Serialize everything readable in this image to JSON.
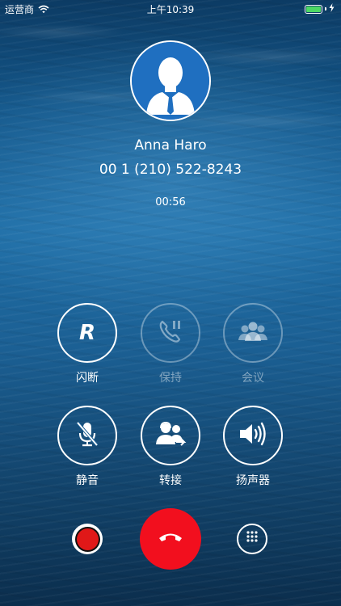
{
  "status_bar": {
    "carrier": "运营商",
    "time": "上午10:39",
    "battery_percent": 100,
    "icons": [
      "wifi-icon",
      "battery-icon",
      "charging-icon"
    ]
  },
  "caller": {
    "name": "Anna  Haro",
    "number": "00 1 (210) 522-8243",
    "duration": "00:56",
    "avatar_icon": "person-avatar-icon"
  },
  "actions": [
    {
      "id": "flash",
      "label": "闪断",
      "icon": "flash-r-icon",
      "glyph": "R",
      "enabled": true
    },
    {
      "id": "hold",
      "label": "保持",
      "icon": "phone-hold-icon",
      "enabled": false
    },
    {
      "id": "conference",
      "label": "会议",
      "icon": "group-icon",
      "enabled": false
    },
    {
      "id": "mute",
      "label": "静音",
      "icon": "mic-muted-icon",
      "enabled": true
    },
    {
      "id": "transfer",
      "label": "转接",
      "icon": "transfer-people-icon",
      "enabled": true
    },
    {
      "id": "speaker",
      "label": "扬声器",
      "icon": "speaker-icon",
      "enabled": true
    }
  ],
  "controls": {
    "record_icon": "record-icon",
    "hangup_icon": "hangup-icon",
    "keypad_icon": "keypad-icon"
  },
  "colors": {
    "hangup": "#f20f1e",
    "record": "#e01818",
    "battery": "#4cd964",
    "avatar_bg": "#1f6fc0"
  }
}
